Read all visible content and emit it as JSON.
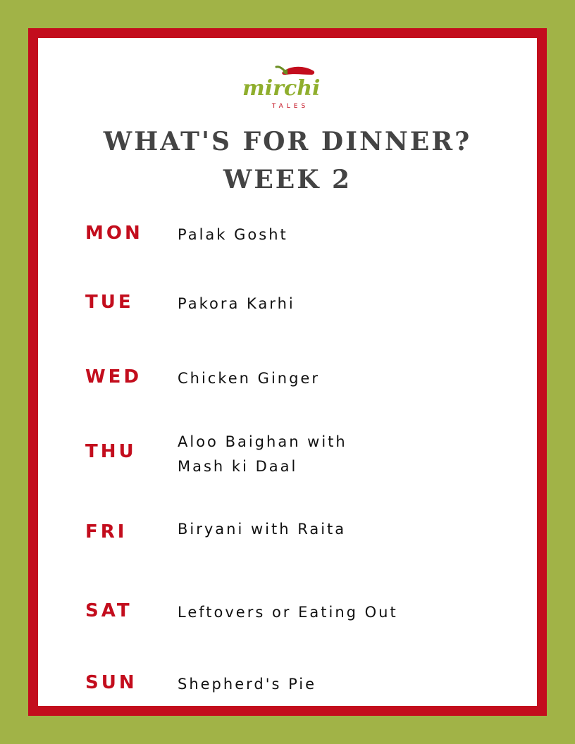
{
  "logo": {
    "brand": "mirchi",
    "tagline": "TALES"
  },
  "title": {
    "line1": "WHAT'S FOR DINNER?",
    "line2": "WEEK 2"
  },
  "menu": [
    {
      "day": "MON",
      "meal_line1": "Palak Gosht",
      "meal_line2": ""
    },
    {
      "day": "TUE",
      "meal_line1": "Pakora Karhi",
      "meal_line2": ""
    },
    {
      "day": "WED",
      "meal_line1": "Chicken Ginger",
      "meal_line2": ""
    },
    {
      "day": "THU",
      "meal_line1": "Aloo Baighan with",
      "meal_line2": "Mash ki Daal"
    },
    {
      "day": "FRI",
      "meal_line1": "Biryani with Raita",
      "meal_line2": ""
    },
    {
      "day": "SAT",
      "meal_line1": "Leftovers or Eating Out",
      "meal_line2": ""
    },
    {
      "day": "SUN",
      "meal_line1": "Shepherd's Pie",
      "meal_line2": ""
    }
  ],
  "colors": {
    "background": "#a1b347",
    "frame": "#c30d1d",
    "accent_red": "#c30d1d",
    "logo_green": "#8fae2d",
    "title_gray": "#444444"
  }
}
